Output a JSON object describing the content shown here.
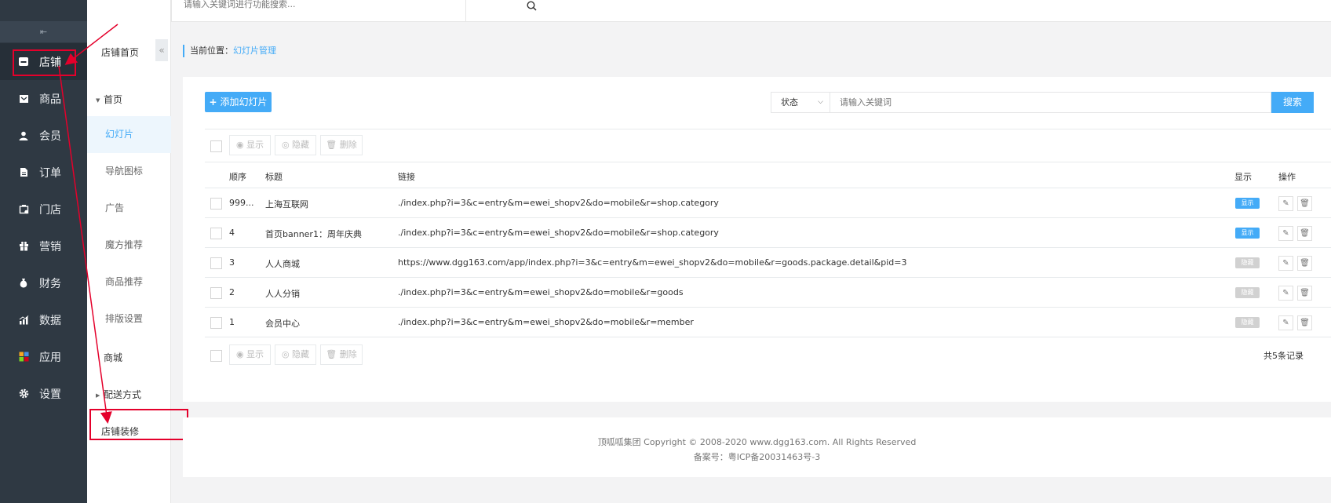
{
  "topbar": {
    "search_placeholder": "请输入关键词进行功能搜索..."
  },
  "main_nav": {
    "collapse_glyph": "⇤",
    "items": [
      {
        "label": "店铺",
        "icon": "store-icon",
        "active": true
      },
      {
        "label": "商品",
        "icon": "goods-icon"
      },
      {
        "label": "会员",
        "icon": "user-icon"
      },
      {
        "label": "订单",
        "icon": "order-icon"
      },
      {
        "label": "门店",
        "icon": "shop-icon"
      },
      {
        "label": "营销",
        "icon": "gift-icon"
      },
      {
        "label": "财务",
        "icon": "money-bag-icon"
      },
      {
        "label": "数据",
        "icon": "bar-chart-icon"
      },
      {
        "label": "应用",
        "icon": "apps-icon"
      },
      {
        "label": "设置",
        "icon": "gear-icon"
      }
    ]
  },
  "sub_nav": {
    "title": "店铺首页",
    "groups": {
      "home": "首页",
      "mall": "商城",
      "delivery": "配送方式"
    },
    "items": [
      "幻灯片",
      "导航图标",
      "广告",
      "魔方推荐",
      "商品推荐",
      "排版设置"
    ],
    "decor": "店铺装修"
  },
  "breadcrumb": {
    "prefix": "当前位置：",
    "current": "幻灯片管理"
  },
  "toolbar": {
    "add_label": "添加幻灯片",
    "status_label": "状态",
    "keyword_placeholder": "请输入关键词",
    "search_label": "搜索",
    "show_label": "显示",
    "hide_label": "隐藏",
    "delete_label": "删除"
  },
  "table": {
    "headers": {
      "order": "顺序",
      "title": "标题",
      "link": "链接",
      "display": "显示",
      "ops": "操作"
    },
    "rows": [
      {
        "order": "999...",
        "title": "上海互联网",
        "link": "./index.php?i=3&c=entry&m=ewei_shopv2&do=mobile&r=shop.category",
        "status": "显示",
        "visible": true
      },
      {
        "order": "4",
        "title": "首页banner1：周年庆典",
        "link": "./index.php?i=3&c=entry&m=ewei_shopv2&do=mobile&r=shop.category",
        "status": "显示",
        "visible": true
      },
      {
        "order": "3",
        "title": "人人商城",
        "link": "https://www.dgg163.com/app/index.php?i=3&c=entry&m=ewei_shopv2&do=mobile&r=goods.package.detail&pid=3",
        "status": "隐藏",
        "visible": false
      },
      {
        "order": "2",
        "title": "人人分销",
        "link": "./index.php?i=3&c=entry&m=ewei_shopv2&do=mobile&r=goods",
        "status": "隐藏",
        "visible": false
      },
      {
        "order": "1",
        "title": "会员中心",
        "link": "./index.php?i=3&c=entry&m=ewei_shopv2&do=mobile&r=member",
        "status": "隐藏",
        "visible": false
      }
    ],
    "total": "共5条记录"
  },
  "footer": {
    "copyright": "顶呱呱集团 Copyright © 2008-2020 www.dgg163.com. All Rights Reserved",
    "icp": "备案号：粤ICP备20031463号-3"
  },
  "colors": {
    "accent": "#44abf7",
    "sidebar": "#2f3943",
    "annotation": "#e4002b"
  }
}
